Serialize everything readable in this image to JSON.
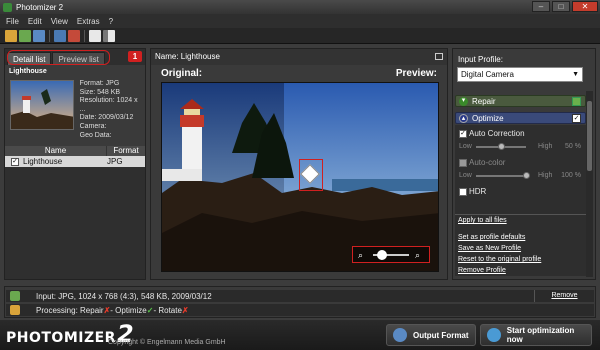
{
  "window": {
    "title": "Photomizer 2",
    "minimize": "–",
    "maximize": "□",
    "close": "✕"
  },
  "menu": [
    "File",
    "Edit",
    "View",
    "Extras",
    "?"
  ],
  "left_panel": {
    "tabs": [
      "Detail list",
      "Preview list"
    ],
    "badge": "1",
    "file_title": "Lighthouse",
    "meta": [
      "Format: JPG",
      "Size: 548 KB",
      "Resolution: 1024 x ...",
      "Date: 2009/03/12",
      "Camera:",
      "Geo Data:"
    ],
    "columns": [
      "Name",
      "Format"
    ],
    "rows": [
      {
        "name": "Lighthouse",
        "format": "JPG",
        "checked": "✓"
      }
    ]
  },
  "center": {
    "name_label": "Name: Lighthouse",
    "original_label": "Original:",
    "preview_label": "Preview:"
  },
  "right_panel": {
    "input_profile_label": "Input Profile:",
    "profile_value": "Digital Camera",
    "repair_label": "Repair",
    "optimize_label": "Optimize",
    "auto_correction": "Auto Correction",
    "auto_color": "Auto-color",
    "hdr": "HDR",
    "low": "Low",
    "high": "High",
    "slider1_value": "50 %",
    "slider2_value": "100 %",
    "slider1_level": 0.5,
    "slider2_level": 1.0,
    "links": [
      "Apply to all files",
      "Set as profile defaults",
      "Save as New Profile",
      "Reset to the original profile",
      "Remove Profile"
    ]
  },
  "status": {
    "input_line": "Input: JPG, 1024 x 768 (4:3), 548 KB, 2009/03/12",
    "remove": "Remove",
    "processing_prefix": "Processing: Repair",
    "sep1": " - Optimize ",
    "sep2": " - Rotate ",
    "x_mark": "✗",
    "check_mark": "✓"
  },
  "footer": {
    "logo_word": "PHOTOMIZER",
    "logo_num": "2",
    "copyright": "Copyright © Engelmann Media GmbH",
    "output_format": "Output Format",
    "start": "Start optimization now"
  },
  "colors": {
    "accent_red": "#d02020",
    "repair_green": "#3a8a2a",
    "optimize_blue": "#3a4a7a"
  }
}
